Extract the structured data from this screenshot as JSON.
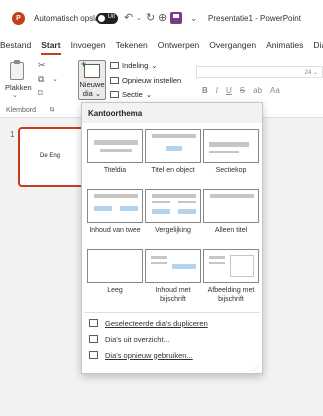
{
  "titlebar": {
    "autosave": "Automatisch opslaan",
    "toggle_state": "Uit",
    "document_title": "Presentatie1 - PowerPoint"
  },
  "tabs": [
    {
      "label": "Bestand"
    },
    {
      "label": "Start",
      "active": true
    },
    {
      "label": "Invoegen"
    },
    {
      "label": "Tekenen"
    },
    {
      "label": "Ontwerpen"
    },
    {
      "label": "Overgangen"
    },
    {
      "label": "Animaties"
    },
    {
      "label": "Dia"
    }
  ],
  "ribbon": {
    "paste_label": "Plakken",
    "clipboard_group": "Klembord",
    "new_slide_line1": "Nieuwe",
    "new_slide_line2": "dia",
    "layout_label": "Indeling",
    "reset_label": "Opnieuw instellen",
    "section_label": "Sectie",
    "font_size_hint": "24",
    "accent": "#c43e1c"
  },
  "slide_pane": {
    "slide_number": "1",
    "thumb_text": "De Eng"
  },
  "dropdown": {
    "header": "Kantoorthema",
    "layouts": [
      {
        "label": "Titeldia"
      },
      {
        "label": "Titel en object"
      },
      {
        "label": "Sectiekop"
      },
      {
        "label": "Inhoud van twee"
      },
      {
        "label": "Vergelijking"
      },
      {
        "label": "Alleen titel"
      },
      {
        "label": "Leeg"
      },
      {
        "label": "Inhoud met bijschrift"
      },
      {
        "label": "Afbeelding met bijschrift"
      }
    ],
    "actions": [
      {
        "label": "Geselecteerde dia's dupliceren",
        "icon": "duplicate-icon"
      },
      {
        "label": "Dia's uit overzicht...",
        "icon": "outline-icon"
      },
      {
        "label": "Dia's opnieuw gebruiken...",
        "icon": "reuse-icon"
      }
    ]
  }
}
